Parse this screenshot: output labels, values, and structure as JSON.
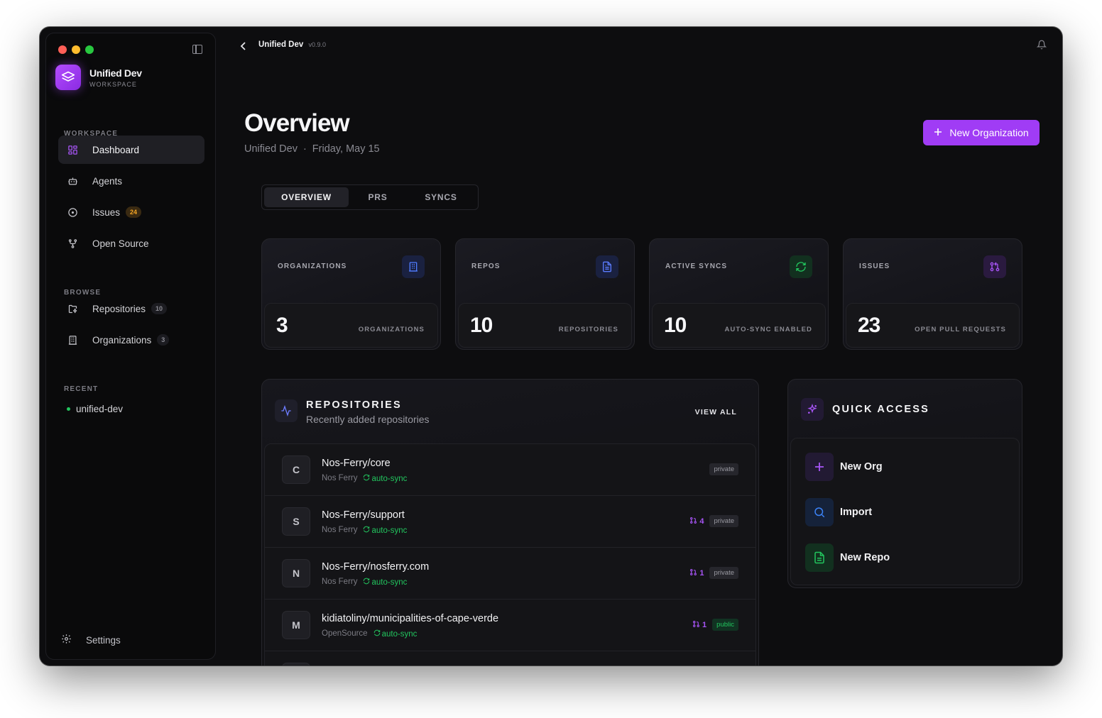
{
  "app": {
    "name": "Unified Dev",
    "workspace_label": "WORKSPACE",
    "version": "v0.9.0"
  },
  "sidebar": {
    "sections": {
      "workspace": "WORKSPACE",
      "browse": "BROWSE",
      "recent": "RECENT"
    },
    "items": [
      {
        "label": "Dashboard",
        "icon": "dashboard-icon"
      },
      {
        "label": "Agents",
        "icon": "bot-icon"
      },
      {
        "label": "Issues",
        "icon": "circle-dot-icon",
        "badge": "24"
      },
      {
        "label": "Open Source",
        "icon": "git-fork-icon"
      },
      {
        "label": "Repositories",
        "icon": "folder-git-icon",
        "badge": "10"
      },
      {
        "label": "Organizations",
        "icon": "building-icon",
        "badge": "3"
      }
    ],
    "recent": [
      {
        "label": "unified-dev"
      }
    ],
    "settings_label": "Settings"
  },
  "page": {
    "title": "Overview",
    "subtitle_org": "Unified Dev",
    "subtitle_sep": "·",
    "subtitle_date": "Friday, May 15",
    "new_org_button": "New Organization"
  },
  "tabs": [
    {
      "label": "OVERVIEW",
      "active": true
    },
    {
      "label": "PRS"
    },
    {
      "label": "SYNCS"
    }
  ],
  "stats": [
    {
      "label": "ORGANIZATIONS",
      "value": "3",
      "caption": "ORGANIZATIONS",
      "icon": "building-icon",
      "color": "#4f7cff"
    },
    {
      "label": "REPOS",
      "value": "10",
      "caption": "REPOSITORIES",
      "icon": "file-text-icon",
      "color": "#5b7cff"
    },
    {
      "label": "ACTIVE SYNCS",
      "value": "10",
      "caption": "AUTO-SYNC ENABLED",
      "icon": "refresh-icon",
      "color": "#22c55e"
    },
    {
      "label": "ISSUES",
      "value": "23",
      "caption": "OPEN PULL REQUESTS",
      "icon": "git-pull-request-icon",
      "color": "#a855f7"
    }
  ],
  "repositories": {
    "title": "REPOSITORIES",
    "subtitle": "Recently added repositories",
    "view_all": "VIEW ALL",
    "rows": [
      {
        "initial": "C",
        "name": "Nos-Ferry/core",
        "org": "Nos Ferry",
        "sync": "auto-sync",
        "prs": "",
        "visibility": "private"
      },
      {
        "initial": "S",
        "name": "Nos-Ferry/support",
        "org": "Nos Ferry",
        "sync": "auto-sync",
        "prs": "4",
        "visibility": "private"
      },
      {
        "initial": "N",
        "name": "Nos-Ferry/nosferry.com",
        "org": "Nos Ferry",
        "sync": "auto-sync",
        "prs": "1",
        "visibility": "private"
      },
      {
        "initial": "M",
        "name": "kidiatoliny/municipalities-of-cape-verde",
        "org": "OpenSource",
        "sync": "auto-sync",
        "prs": "1",
        "visibility": "public"
      }
    ]
  },
  "quick_access": {
    "title": "QUICK ACCESS",
    "items": [
      {
        "label": "New Org",
        "icon": "plus-icon",
        "color": "#a855f7"
      },
      {
        "label": "Import",
        "icon": "search-icon",
        "color": "#3b82f6"
      },
      {
        "label": "New Repo",
        "icon": "file-icon",
        "color": "#22c55e"
      }
    ]
  }
}
